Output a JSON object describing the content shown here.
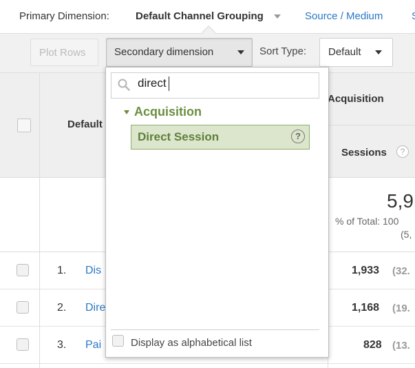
{
  "primary_dimension": {
    "label": "Primary Dimension:",
    "active": "Default Channel Grouping",
    "link_source_medium": "Source / Medium",
    "link_partial": "S"
  },
  "toolbar": {
    "plot_rows": "Plot Rows",
    "secondary_dimension": "Secondary dimension",
    "sort_type_label": "Sort Type:",
    "sort_type_value": "Default"
  },
  "table": {
    "header_default": "Default",
    "header_acquisition": "Acquisition",
    "header_sessions": "Sessions",
    "help_glyph": "?",
    "total_value": "5,9",
    "total_pct": "% of Total: 100",
    "total_avg": "(5,",
    "rows": [
      {
        "num": "1.",
        "name": "Dis",
        "value": "1,933",
        "pct": "(32."
      },
      {
        "num": "2.",
        "name": "Dire",
        "value": "1,168",
        "pct": "(19."
      },
      {
        "num": "3.",
        "name": "Pai",
        "value": "828",
        "pct": "(13."
      }
    ]
  },
  "dropdown": {
    "search_value": "direct",
    "category": "Acquisition",
    "option": "Direct Session",
    "option_help": "?",
    "alphabetical_label": "Display as alphabetical list"
  },
  "colors": {
    "link": "#2a78c4",
    "category_green": "#6b8f3f",
    "option_bg": "#dbe6cd",
    "option_border": "#8ead6b"
  }
}
